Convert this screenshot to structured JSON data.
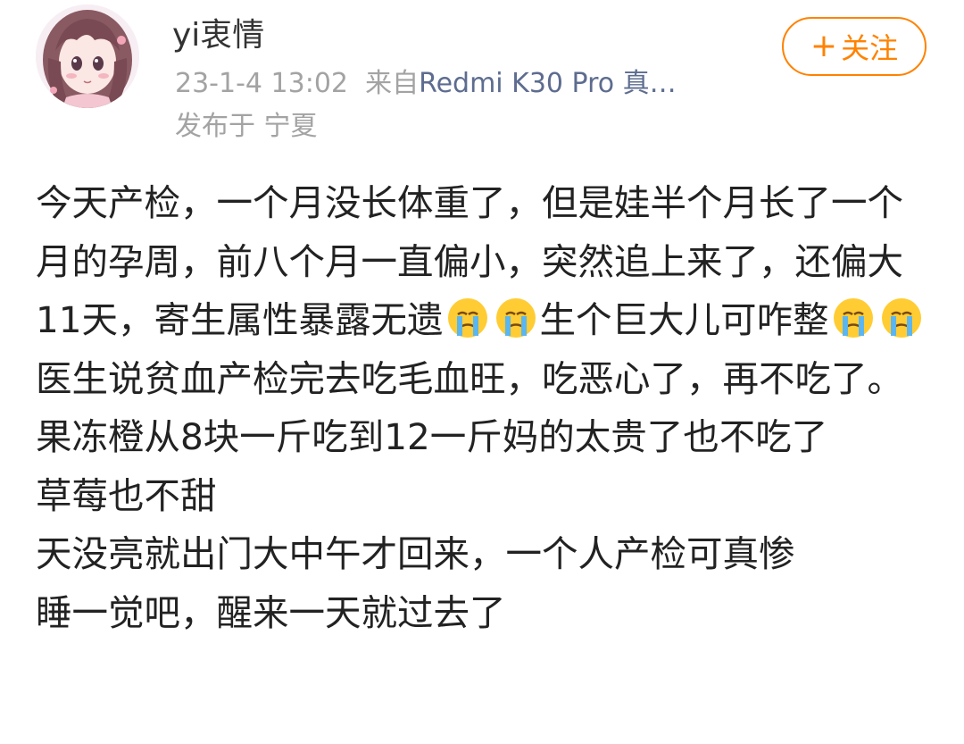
{
  "user": {
    "name": "yi衷情"
  },
  "post_meta": {
    "time": "23-1-4 13:02",
    "source_prefix": "来自",
    "source": "Redmi K30 Pro 真…",
    "location": "发布于 宁夏"
  },
  "follow": {
    "plus": "+",
    "label": "关注",
    "color": "#ff8200"
  },
  "emoji_name": "crying-face",
  "content": {
    "p1_a": "今天产检，一个月没长体重了，但是娃半个月长了一个月的孕周，前八个月一直偏小，突然追上来了，还偏大11天，寄生属性暴露无遗",
    "p1_b": "生个巨大儿可咋整",
    "p2": "医生说贫血产检完去吃毛血旺，吃恶心了，再不吃了。",
    "p3": "果冻橙从8块一斤吃到12一斤妈的太贵了也不吃了",
    "p4": "草莓也不甜",
    "p5": "天没亮就出门大中午才回来，一个人产检可真惨",
    "p6": "睡一觉吧，醒来一天就过去了"
  }
}
